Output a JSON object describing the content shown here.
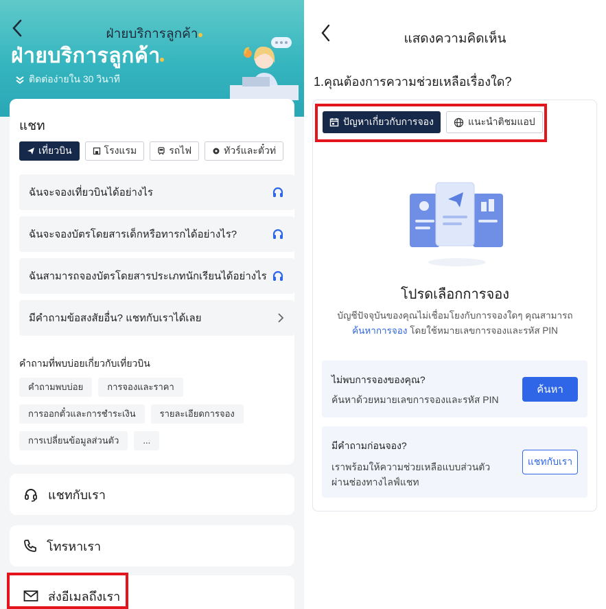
{
  "left": {
    "nav_title": "ฝ่ายบริการลูกค้า",
    "hero_title": "ฝ่ายบริการลูกค้า",
    "hero_subtitle": "ติดต่อง่ายใน 30 วินาที",
    "chat_card": {
      "title": "แชท",
      "tabs": [
        {
          "label": "เที่ยวบิน",
          "icon": "plane-icon",
          "active": true
        },
        {
          "label": "โรงแรม",
          "icon": "hotel-icon",
          "active": false
        },
        {
          "label": "รถไฟ",
          "icon": "train-icon",
          "active": false
        },
        {
          "label": "ทัวร์และตั๋วท่",
          "icon": "tour-icon",
          "active": false
        }
      ],
      "faqs": [
        {
          "label": "ฉันจะจองเที่ยวบินได้อย่างไร",
          "icon": "headset-icon"
        },
        {
          "label": "ฉันจะจองบัตรโดยสารเด็กหรือทารกได้อย่างไร?",
          "icon": "headset-icon"
        },
        {
          "label": "ฉันสามารถจองบัตรโดยสารประเภทนักเรียนได้อย่างไร",
          "icon": "headset-icon"
        },
        {
          "label": "มีคำถามข้อสงสัยอื่น? แชทกับเราได้เลย",
          "icon": "chevron-right-icon"
        }
      ],
      "faq_heading": "คำถามที่พบบ่อยเกี่ยวกับเที่ยวบิน",
      "chips": [
        "คำถามพบบ่อย",
        "การจองและราคา",
        "การออกตั๋วและการชำระเงิน",
        "รายละเอียดการจอง",
        "การเปลี่ยนข้อมูลส่วนตัว",
        "..."
      ]
    },
    "chat_us": "แชทกับเรา",
    "call_us": "โทรหาเรา",
    "email_us": "ส่งอีเมลถึงเรา"
  },
  "right": {
    "nav_title": "แสดงความคิดเห็น",
    "question": "1.คุณต้องการความช่วยเหลือเรื่องใด?",
    "tabs": [
      {
        "label": "ปัญหาเกี่ยวกับการจอง",
        "icon": "calendar-icon",
        "active": true
      },
      {
        "label": "แนะนำติชมแอป",
        "icon": "globe-icon",
        "active": false
      }
    ],
    "select_title": "โปรดเลือกการจอง",
    "select_desc_1": "บัญชีปัจจุบันของคุณไม่เชื่อมโยงกับการจองใดๆ คุณสามารถ",
    "select_desc_link": "ค้นหาการจอง",
    "select_desc_2": "โดยใช้หมายเลขการจองและรหัส PIN",
    "not_found": {
      "title": "ไม่พบการจองของคุณ?",
      "desc": "ค้นหาด้วยหมายเลขการจองและรหัส PIN",
      "button": "ค้นหา"
    },
    "pre_booking": {
      "title": "มีคำถามก่อนจอง?",
      "desc_1": "เราพร้อมให้ความช่วยเหลือแบบส่วนตัว",
      "desc_2": "ผ่านช่องทางไลฟ์แชท",
      "button": "แชทกับเรา"
    }
  },
  "colors": {
    "header_teal": "#35b5bf",
    "navy": "#17294a",
    "primary_blue": "#2f66e8",
    "highlight_red": "#e3141b"
  }
}
